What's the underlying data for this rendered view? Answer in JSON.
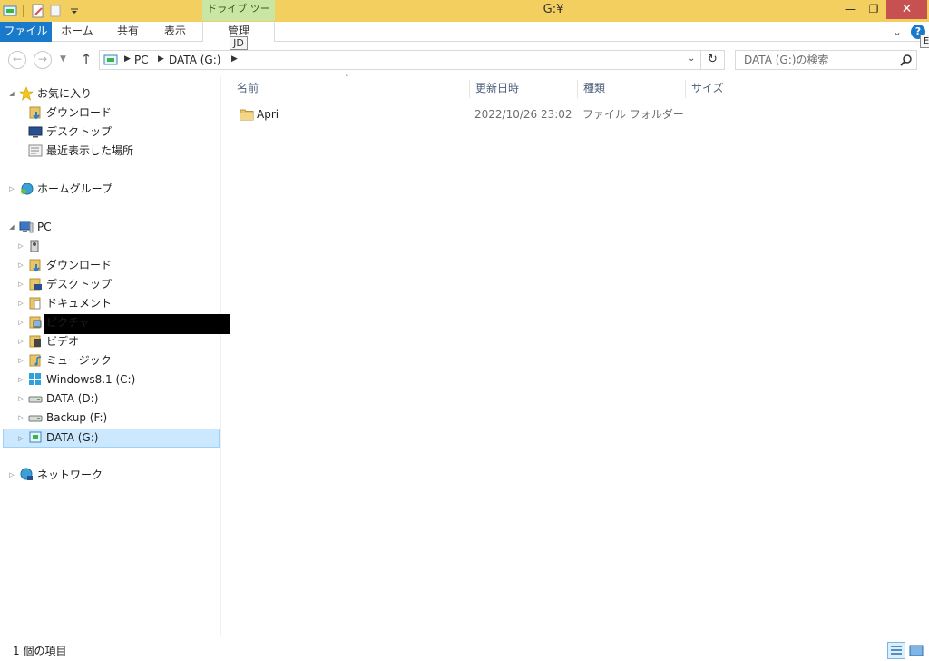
{
  "window": {
    "title": "G:¥",
    "context_tab_header": "ドライブ ツール",
    "minimize": "—",
    "maximize": "❐",
    "close": "✕"
  },
  "ribbon": {
    "tabs": [
      "ファイル",
      "ホーム",
      "共有",
      "表示",
      "管理"
    ],
    "keytip": "JD",
    "help_label": "?",
    "help_keytip": "E"
  },
  "address": {
    "crumbs": [
      "PC",
      "DATA (G:)"
    ],
    "search_placeholder": "DATA (G:)の検索"
  },
  "nav": {
    "favorites": {
      "label": "お気に入り",
      "items": [
        "ダウンロード",
        "デスクトップ",
        "最近表示した場所"
      ]
    },
    "homegroup": "ホームグループ",
    "pc": {
      "label": "PC",
      "items": [
        "ダウンロード",
        "デスクトップ",
        "ドキュメント",
        "ピクチャ",
        "ビデオ",
        "ミュージック",
        "Windows8.1 (C:)",
        "DATA (D:)",
        "Backup (F:)",
        "DATA (G:)"
      ]
    },
    "network": "ネットワーク"
  },
  "columns": [
    "名前",
    "更新日時",
    "種類",
    "サイズ"
  ],
  "files": [
    {
      "name": "Apri",
      "modified": "2022/10/26 23:02",
      "type": "ファイル フォルダー",
      "size": ""
    }
  ],
  "status": {
    "item_count": "1 個の項目"
  },
  "colors": {
    "title_bar": "#f3cf5f",
    "context_tab": "#c9e6a5",
    "file_tab": "#1979ca",
    "close_button": "#c75050",
    "selection": "#cce8ff"
  }
}
